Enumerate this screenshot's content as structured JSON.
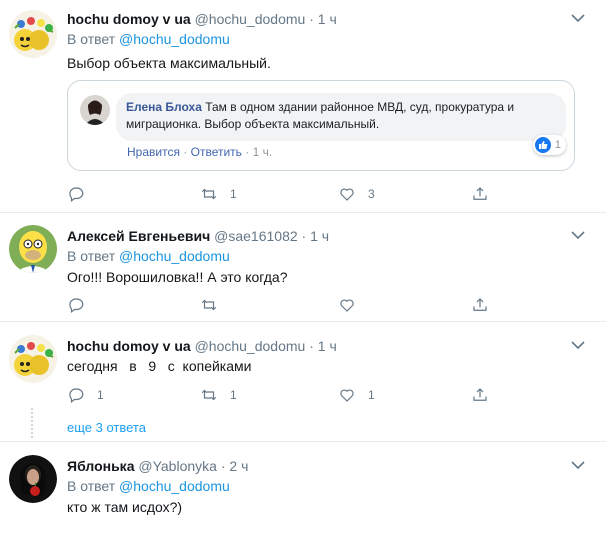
{
  "tweets": [
    {
      "name": "hochu domoy v ua",
      "handle": "@hochu_dodomu",
      "dot": "·",
      "time": "1 ч",
      "reply_prefix": "В ответ",
      "reply_to": "@hochu_dodomu",
      "text": "Выбор объекта максимальный.",
      "embed": {
        "author": "Елена Блоха",
        "comment": "Там в одном здании районное МВД, суд, прокуратура и миграционка. Выбор объекта максимальный.",
        "like_label": "Нравится",
        "sep": "·",
        "reply_label": "Ответить",
        "time": "1 ч.",
        "reaction_count": "1"
      },
      "stats": {
        "replies": "",
        "retweets": "1",
        "likes": "3"
      }
    },
    {
      "name": "Алексей Евгеньевич",
      "handle": "@sae161082",
      "dot": "·",
      "time": "1 ч",
      "reply_prefix": "В ответ",
      "reply_to": "@hochu_dodomu",
      "text": "Ого!!! Ворошиловка!! А это когда?",
      "stats": {
        "replies": "",
        "retweets": "",
        "likes": ""
      }
    },
    {
      "name": "hochu domoy v ua",
      "handle": "@hochu_dodomu",
      "dot": "·",
      "time": "1 ч",
      "text": "сегодня   в   9   с  копейками",
      "stats": {
        "replies": "1",
        "retweets": "1",
        "likes": "1"
      }
    },
    {
      "name": "Яблонька",
      "handle": "@Yablonyka",
      "dot": "·",
      "time": "2 ч",
      "reply_prefix": "В ответ",
      "reply_to": "@hochu_dodomu",
      "text": "кто ж там исдох?)"
    }
  ],
  "more_replies": "еще 3 ответа",
  "colors": {
    "link": "#1b95e0",
    "muted": "#657786",
    "divider": "#e6ecf0"
  }
}
